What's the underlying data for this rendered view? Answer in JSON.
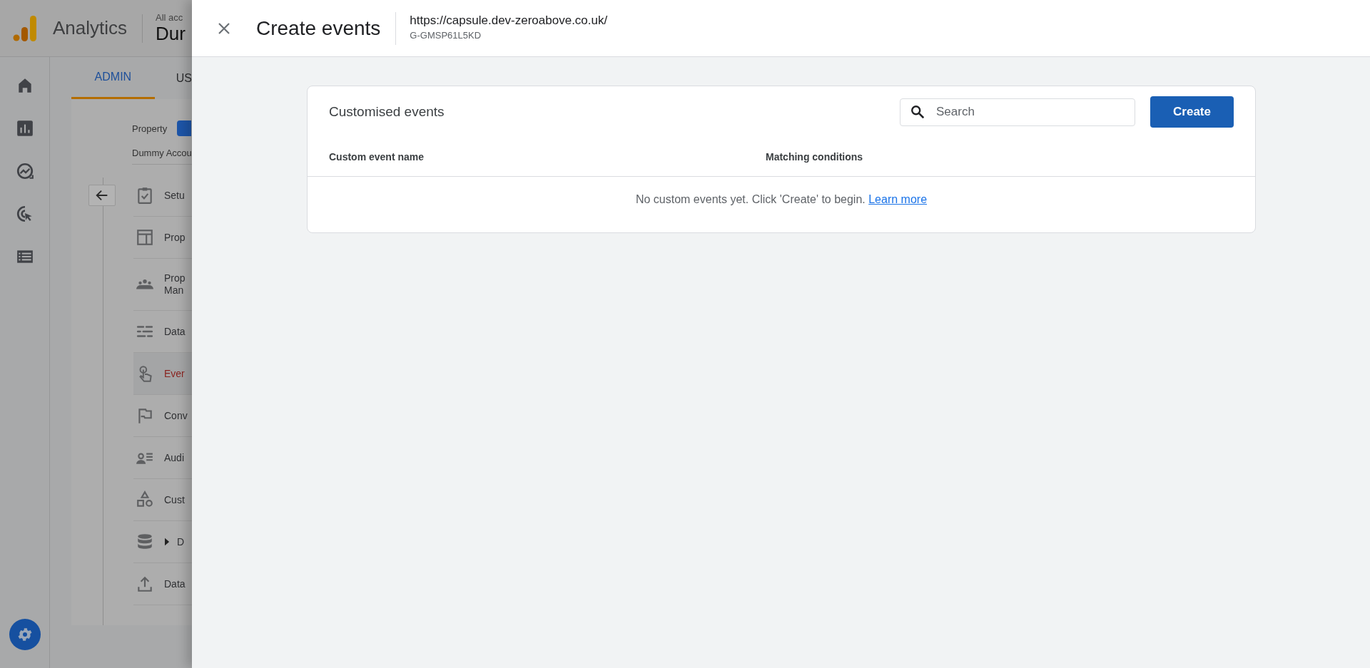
{
  "background_app": {
    "brand": "Analytics",
    "account_label": "All acc",
    "account_name": "Dur",
    "tabs": [
      {
        "label": "ADMIN",
        "selected": true
      },
      {
        "label": "US",
        "selected": false
      }
    ],
    "property_label": "Property",
    "account_path": "Dummy Accou",
    "nav_items": [
      {
        "lines": [
          "Setu"
        ],
        "selected": false
      },
      {
        "lines": [
          "Prop"
        ],
        "selected": false
      },
      {
        "lines": [
          "Prop",
          "Man"
        ],
        "selected": false
      },
      {
        "lines": [
          "Data"
        ],
        "selected": false
      },
      {
        "lines": [
          "Ever"
        ],
        "selected": true
      },
      {
        "lines": [
          "Conv"
        ],
        "selected": false
      },
      {
        "lines": [
          "Audi"
        ],
        "selected": false
      },
      {
        "lines": [
          "Cust"
        ],
        "selected": false
      },
      {
        "lines": [
          "D"
        ],
        "selected": false,
        "expanded": false
      },
      {
        "lines": [
          "Data"
        ],
        "selected": false
      }
    ]
  },
  "panel": {
    "title": "Create events",
    "stream_url": "https://capsule.dev-zeroabove.co.uk/",
    "measurement_id": "G-GMSP61L5KD",
    "card": {
      "title": "Customised events",
      "search": {
        "placeholder": "Search"
      },
      "create_button": "Create",
      "columns": [
        "Custom event name",
        "Matching conditions"
      ],
      "empty_message": "No custom events yet. Click 'Create' to begin.",
      "empty_link": "Learn more"
    }
  }
}
